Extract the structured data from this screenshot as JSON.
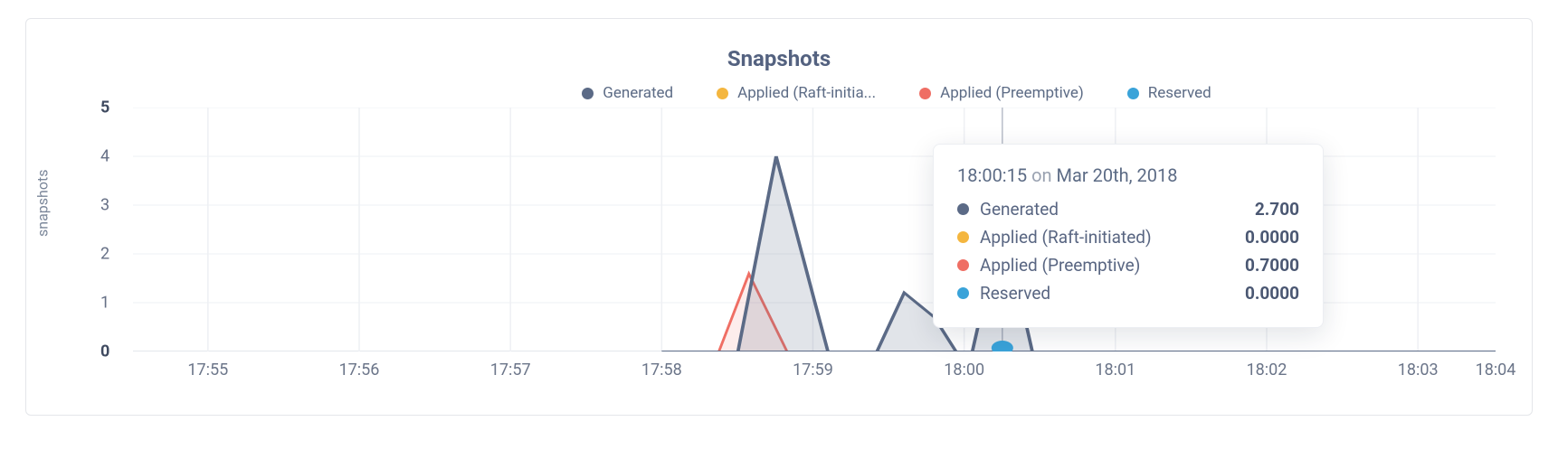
{
  "title": "Snapshots",
  "ylabel": "snapshots",
  "legend": [
    {
      "label": "Generated",
      "color": "#5b6a86"
    },
    {
      "label": "Applied (Raft-initia...",
      "color": "#f4b63f"
    },
    {
      "label": "Applied (Preemptive)",
      "color": "#ef6e64"
    },
    {
      "label": "Reserved",
      "color": "#3aa3d9"
    }
  ],
  "yticks": [
    "5",
    "4",
    "3",
    "2",
    "1",
    "0"
  ],
  "xticks": [
    "17:55",
    "17:56",
    "17:57",
    "17:58",
    "17:59",
    "18:00",
    "18:01",
    "18:02",
    "18:03",
    "18:04"
  ],
  "tooltip": {
    "time": "18:00:15",
    "on": "on",
    "date": "Mar 20th, 2018",
    "rows": [
      {
        "label": "Generated",
        "value": "2.700",
        "color": "#5b6a86"
      },
      {
        "label": "Applied (Raft-initiated)",
        "value": "0.0000",
        "color": "#f4b63f"
      },
      {
        "label": "Applied (Preemptive)",
        "value": "0.7000",
        "color": "#ef6e64"
      },
      {
        "label": "Reserved",
        "value": "0.0000",
        "color": "#3aa3d9"
      }
    ]
  },
  "chart_data": {
    "type": "line",
    "title": "Snapshots",
    "xlabel": "",
    "ylabel": "snapshots",
    "ylim": [
      0,
      5
    ],
    "x": [
      "17:55",
      "17:56",
      "17:57",
      "17:58",
      "17:58:30",
      "17:58:45",
      "17:59",
      "17:59:30",
      "17:59:45",
      "18:00",
      "18:00:15",
      "18:00:30",
      "18:01",
      "18:02",
      "18:03",
      "18:04"
    ],
    "series": [
      {
        "name": "Generated",
        "color": "#5b6a86",
        "values": [
          0,
          0,
          0,
          0,
          0,
          4.0,
          0,
          1.2,
          0.7,
          0,
          2.7,
          0,
          0,
          0,
          0,
          0
        ]
      },
      {
        "name": "Applied (Raft-initiated)",
        "color": "#f4b63f",
        "values": [
          0,
          0,
          0,
          0,
          0,
          0,
          0,
          0,
          0,
          0,
          0.0,
          0,
          0,
          0,
          0,
          0
        ]
      },
      {
        "name": "Applied (Preemptive)",
        "color": "#ef6e64",
        "values": [
          0,
          0,
          0,
          0,
          1.6,
          0,
          0,
          0,
          0,
          0,
          0.7,
          0,
          0,
          0,
          0,
          0
        ]
      },
      {
        "name": "Reserved",
        "color": "#3aa3d9",
        "values": [
          0,
          0,
          0,
          0,
          0,
          0,
          0,
          0,
          0,
          0,
          0.1,
          0,
          0,
          0,
          0,
          0
        ]
      }
    ],
    "hover_point": "18:00:15",
    "tooltip_values": {
      "Generated": 2.7,
      "Applied (Raft-initiated)": 0.0,
      "Applied (Preemptive)": 0.7,
      "Reserved": 0.0
    },
    "legend_position": "top"
  }
}
